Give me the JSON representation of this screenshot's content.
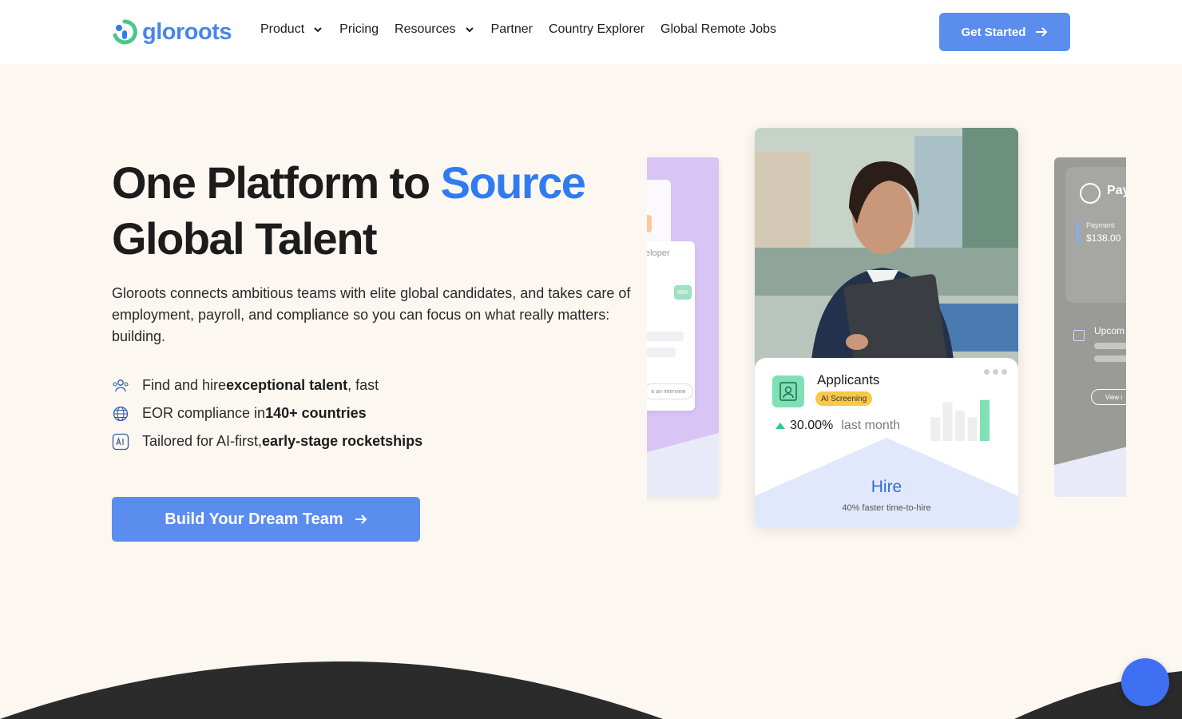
{
  "brand": {
    "name": "gloroots",
    "color": "#4a86e8"
  },
  "nav": {
    "items": [
      {
        "label": "Product",
        "dropdown": true
      },
      {
        "label": "Pricing",
        "dropdown": false
      },
      {
        "label": "Resources",
        "dropdown": true
      },
      {
        "label": "Partner",
        "dropdown": false
      },
      {
        "label": "Country Explorer",
        "dropdown": false
      },
      {
        "label": "Global Remote Jobs",
        "dropdown": false
      }
    ],
    "cta": "Get Started"
  },
  "hero": {
    "title_part1": "One Platform to ",
    "title_accent": "Source",
    "title_part2": "Global Talent",
    "lead": "Gloroots connects ambitious teams with elite global candidates, and takes care of employment, payroll, and compliance so you can focus on what really matters: building.",
    "features": [
      {
        "icon": "people-icon",
        "pre": "Find and hire ",
        "bold": "exceptional talent",
        "post": ", fast"
      },
      {
        "icon": "globe-icon",
        "pre": "EOR compliance in ",
        "bold": "140+ countries",
        "post": ""
      },
      {
        "icon": "ai-icon",
        "pre": "Tailored for AI-first, ",
        "bold": "early-stage rocketships",
        "post": ""
      }
    ],
    "cta": "Build Your Dream Team"
  },
  "carousel": {
    "left_card": {
      "role_fragment": "eloper",
      "score": "98%",
      "button": "e an interview"
    },
    "main_card": {
      "title": "Applicants",
      "badge": "AI Screening",
      "stat_value": "30.00%",
      "stat_label": "last month",
      "bars": [
        0.55,
        0.9,
        0.7,
        0.55,
        0.95
      ],
      "stage": "Hire",
      "stage_sub": "40% faster time-to-hire"
    },
    "right_card": {
      "title": "Pay",
      "payment_label": "Payment",
      "payment_amount": "$138.00",
      "upcoming_label": "Upcom",
      "button": "View i"
    }
  },
  "colors": {
    "accent": "#2f7cf0",
    "cta": "#5b8def",
    "background": "#fdf7f1",
    "green": "#2ec98e"
  }
}
